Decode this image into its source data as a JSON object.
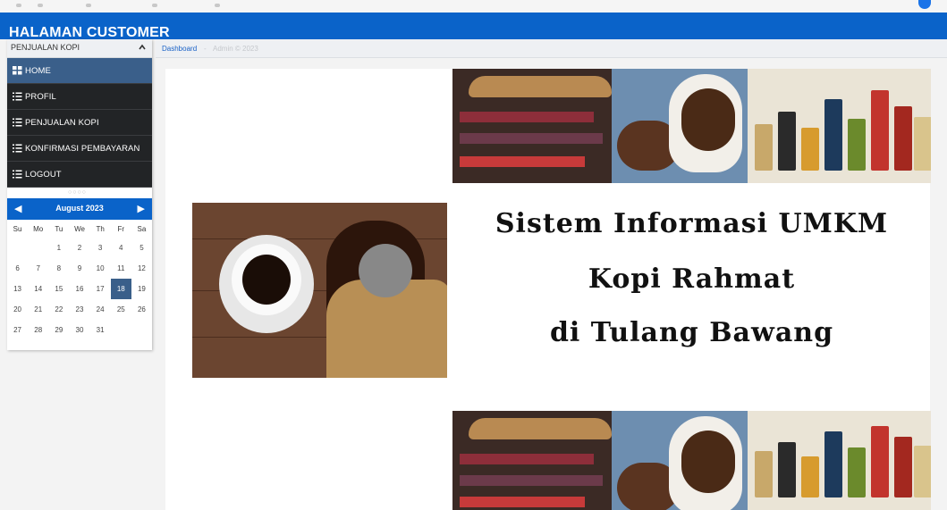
{
  "app": {
    "title": "HALAMAN CUSTOMER"
  },
  "sidebar": {
    "panel_title": "PENJUALAN KOPI",
    "items": [
      {
        "label": "HOME",
        "icon": "grid-icon",
        "active": true
      },
      {
        "label": "PROFIL",
        "icon": "list-icon",
        "active": false
      },
      {
        "label": "PENJUALAN KOPI",
        "icon": "list-icon",
        "active": false
      },
      {
        "label": "KONFIRMASI PEMBAYARAN",
        "icon": "list-icon",
        "active": false
      },
      {
        "label": "LOGOUT",
        "icon": "list-icon",
        "active": false
      }
    ]
  },
  "calendar": {
    "month_label": "August 2023",
    "weekdays": [
      "Su",
      "Mo",
      "Tu",
      "We",
      "Th",
      "Fr",
      "Sa"
    ],
    "weeks": [
      [
        "",
        "",
        "1",
        "2",
        "3",
        "4",
        "5"
      ],
      [
        "6",
        "7",
        "8",
        "9",
        "10",
        "11",
        "12"
      ],
      [
        "13",
        "14",
        "15",
        "16",
        "17",
        "18",
        "19"
      ],
      [
        "20",
        "21",
        "22",
        "23",
        "24",
        "25",
        "26"
      ],
      [
        "27",
        "28",
        "29",
        "30",
        "31",
        "",
        ""
      ]
    ],
    "selected_day": "18"
  },
  "breadcrumb": {
    "link": "Dashboard",
    "separator": "-",
    "footer": "Admin © 2023"
  },
  "main": {
    "headline": {
      "line1": "Sistem Informasi UMKM",
      "line2": "Kopi Rahmat",
      "line3": "di Tulang Bawang"
    }
  },
  "colors": {
    "primary": "#0a63c9",
    "menu_bg": "#222426",
    "menu_active": "#3a5f8a"
  }
}
